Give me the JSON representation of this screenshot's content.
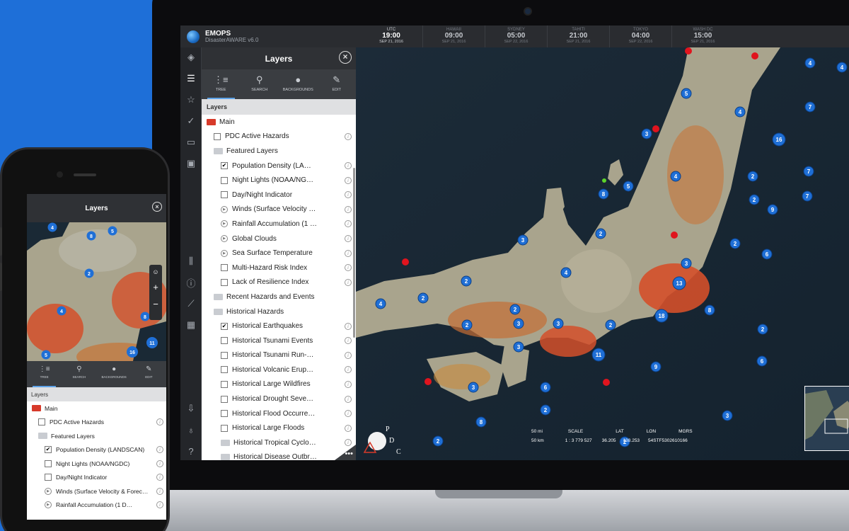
{
  "app": {
    "name": "EMOPS",
    "version": "DisasterAWARE v6.0"
  },
  "clocks": [
    {
      "city": "UTC",
      "time": "19:00",
      "date": "SEP 21, 2016"
    },
    {
      "city": "HAWAII",
      "time": "09:00",
      "date": "SEP 21, 2016"
    },
    {
      "city": "SYDNEY",
      "time": "05:00",
      "date": "SEP 22, 2016"
    },
    {
      "city": "TAHITI",
      "time": "21:00",
      "date": "SEP 21, 2016"
    },
    {
      "city": "TOKYO",
      "time": "04:00",
      "date": "SEP 22, 2016"
    },
    {
      "city": "WASH DC",
      "time": "15:00",
      "date": "SEP 21, 2016"
    }
  ],
  "panel": {
    "title": "Layers",
    "close_icon": "×",
    "section": "Layers",
    "tabs": [
      {
        "label": "TREE",
        "icon": "tree-icon"
      },
      {
        "label": "SEARCH",
        "icon": "search-icon"
      },
      {
        "label": "BACKGROUNDS",
        "icon": "globe-icon"
      },
      {
        "label": "EDIT",
        "icon": "pencil-icon"
      }
    ],
    "more": "•••"
  },
  "tree": [
    {
      "label": "Main",
      "type": "folder-red",
      "indent": 0
    },
    {
      "label": "PDC Active Hazards",
      "type": "checkbox",
      "checked": false,
      "indent": 1,
      "info": true
    },
    {
      "label": "Featured Layers",
      "type": "folder",
      "indent": 1
    },
    {
      "label": "Population Density (LA…",
      "type": "checkbox",
      "checked": true,
      "indent": 2,
      "info": true
    },
    {
      "label": "Night Lights (NOAA/NG…",
      "type": "checkbox",
      "checked": false,
      "indent": 2,
      "info": true
    },
    {
      "label": "Day/Night Indicator",
      "type": "checkbox",
      "checked": false,
      "indent": 2,
      "info": true
    },
    {
      "label": "Winds (Surface Velocity …",
      "type": "play",
      "indent": 2,
      "info": true
    },
    {
      "label": "Rainfall Accumulation (1 …",
      "type": "play",
      "indent": 2,
      "info": true
    },
    {
      "label": "Global Clouds",
      "type": "play",
      "indent": 2,
      "info": true
    },
    {
      "label": "Sea Surface Temperature",
      "type": "play",
      "indent": 2,
      "info": true
    },
    {
      "label": "Multi-Hazard Risk Index",
      "type": "checkbox",
      "checked": false,
      "indent": 2,
      "info": true
    },
    {
      "label": "Lack of Resilience Index",
      "type": "checkbox",
      "checked": false,
      "indent": 2,
      "info": true
    },
    {
      "label": "Recent Hazards and Events",
      "type": "folder",
      "indent": 1
    },
    {
      "label": "Historical Hazards",
      "type": "folder",
      "indent": 1
    },
    {
      "label": "Historical Earthquakes",
      "type": "checkbox",
      "checked": true,
      "indent": 2,
      "info": true
    },
    {
      "label": "Historical Tsunami Events",
      "type": "checkbox",
      "checked": false,
      "indent": 2,
      "info": true
    },
    {
      "label": "Historical Tsunami Run-…",
      "type": "checkbox",
      "checked": false,
      "indent": 2,
      "info": true
    },
    {
      "label": "Historical Volcanic Erup…",
      "type": "checkbox",
      "checked": false,
      "indent": 2,
      "info": true
    },
    {
      "label": "Historical Large Wildfires",
      "type": "checkbox",
      "checked": false,
      "indent": 2,
      "info": true
    },
    {
      "label": "Historical Drought Seve…",
      "type": "checkbox",
      "checked": false,
      "indent": 2,
      "info": true
    },
    {
      "label": "Historical Flood Occurre…",
      "type": "checkbox",
      "checked": false,
      "indent": 2,
      "info": true
    },
    {
      "label": "Historical Large Floods",
      "type": "checkbox",
      "checked": false,
      "indent": 2,
      "info": true
    },
    {
      "label": "Historical Tropical Cyclo…",
      "type": "folder",
      "indent": 2,
      "info": true
    },
    {
      "label": "Historical Disease Outbr…",
      "type": "folder",
      "indent": 2
    }
  ],
  "map": {
    "clusters": [
      "4",
      "4",
      "5",
      "7",
      "4",
      "16",
      "7",
      "3",
      "2",
      "2",
      "7",
      "4",
      "8",
      "5",
      "9",
      "2",
      "2",
      "3",
      "6",
      "4",
      "3",
      "2",
      "13",
      "8",
      "18",
      "2",
      "4",
      "2",
      "3",
      "3",
      "2",
      "2",
      "11",
      "9",
      "6",
      "3",
      "2",
      "8",
      "2",
      "2",
      "3",
      "2",
      "3",
      "6"
    ],
    "scale_labels": {
      "scale_mi": "50 mi",
      "scale_km": "50 km",
      "scale": "SCALE",
      "scale_value": "1 : 3 779 527",
      "lat": "LAT",
      "lat_value": "36.205",
      "lon": "LON",
      "lon_value": "138.253",
      "mgrs": "MGRS",
      "mgrs_value": "54STF5302610166"
    },
    "logo_letters": {
      "p": "P",
      "d": "D",
      "c": "C"
    }
  },
  "phone": {
    "title": "Layers",
    "close_icon": "×",
    "section": "Layers",
    "tabs": [
      {
        "label": "TREE",
        "icon": "tree-icon"
      },
      {
        "label": "SEARCH",
        "icon": "search-icon"
      },
      {
        "label": "BACKGROUNDS",
        "icon": "globe-icon"
      },
      {
        "label": "EDIT",
        "icon": "pencil-icon"
      }
    ],
    "zoom_in": "+",
    "zoom_out": "−",
    "clusters": [
      "4",
      "8",
      "5",
      "2",
      "4",
      "8",
      "11",
      "16",
      "5"
    ],
    "tree": [
      {
        "label": "Main",
        "type": "folder-red",
        "indent": 0
      },
      {
        "label": "PDC Active Hazards",
        "type": "checkbox",
        "checked": false,
        "indent": 1,
        "info": true
      },
      {
        "label": "Featured Layers",
        "type": "folder",
        "indent": 1
      },
      {
        "label": "Population Density (LANDSCAN)",
        "type": "checkbox",
        "checked": true,
        "indent": 2,
        "info": true
      },
      {
        "label": "Night Lights (NOAA/NGDC)",
        "type": "checkbox",
        "checked": false,
        "indent": 2,
        "info": true
      },
      {
        "label": "Day/Night Indicator",
        "type": "checkbox",
        "checked": false,
        "indent": 2,
        "info": true
      },
      {
        "label": "Winds (Surface Velocity & Forec…",
        "type": "play",
        "indent": 2,
        "info": true
      },
      {
        "label": "Rainfall Accumulation (1 D…",
        "type": "play",
        "indent": 2,
        "info": true
      }
    ]
  },
  "colors": {
    "background": "#1e6fd8",
    "cluster": "#1f6fd6",
    "hazard_dot": "#e0141e",
    "accent": "#5ea3e8"
  }
}
